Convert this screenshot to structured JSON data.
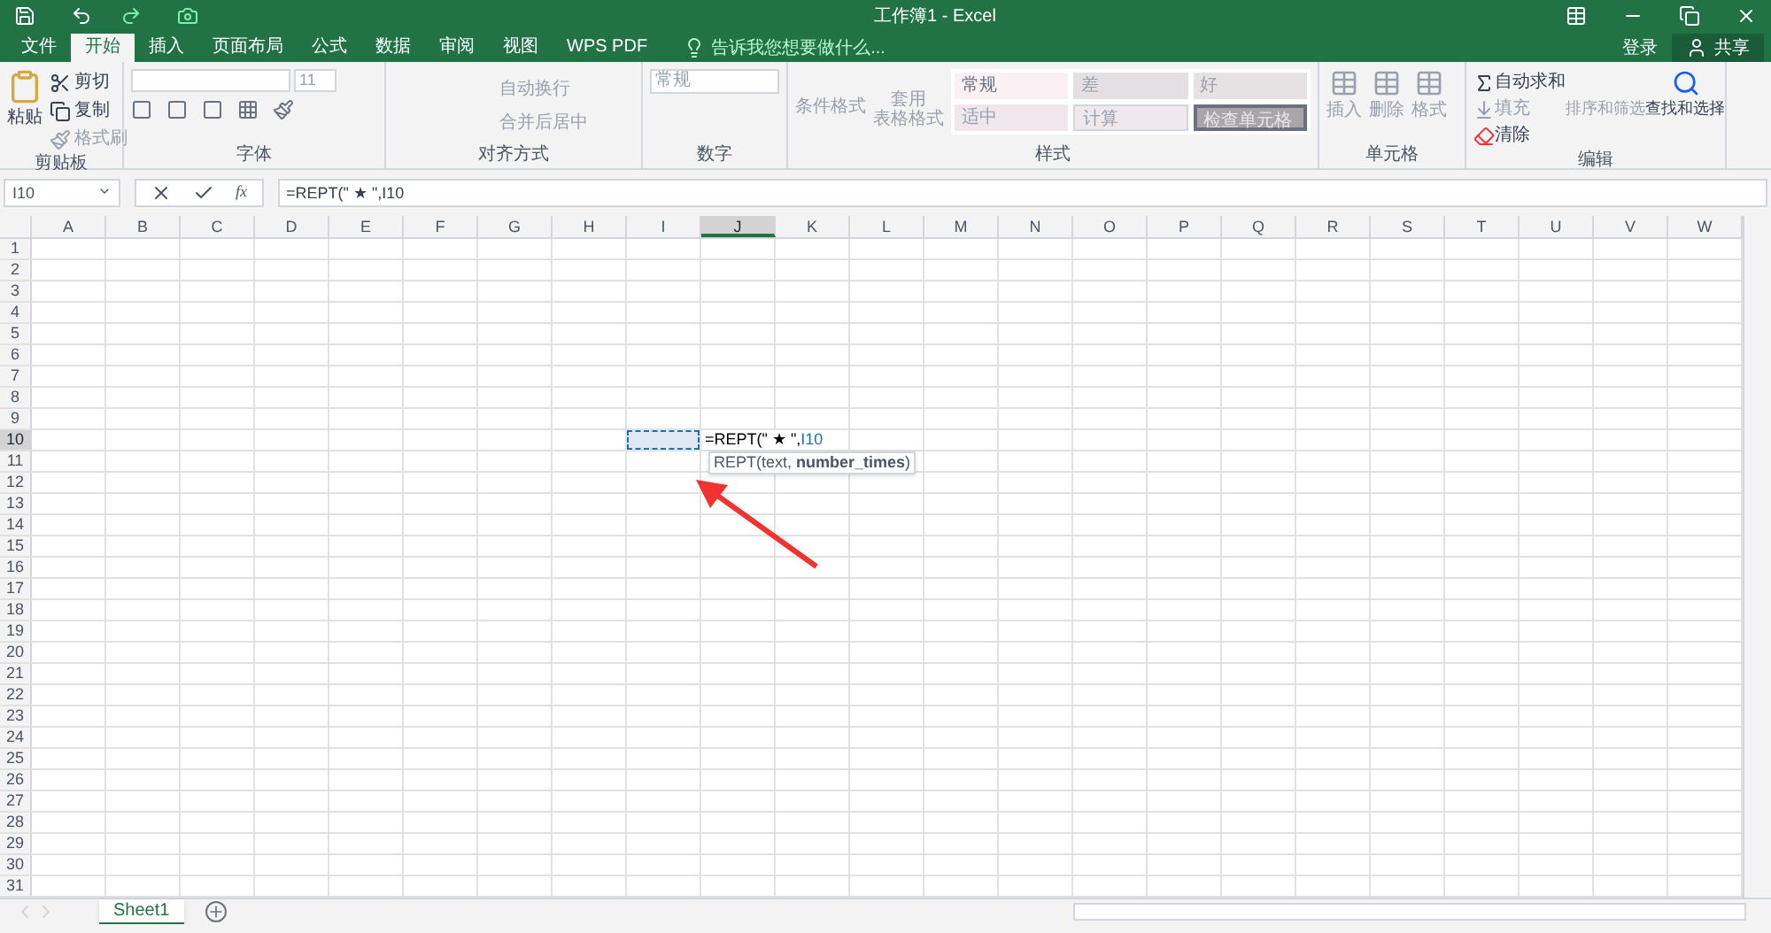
{
  "window": {
    "title": "工作簿1 - Excel"
  },
  "tabs": [
    {
      "label": "文件",
      "selected": false
    },
    {
      "label": "开始",
      "selected": true
    },
    {
      "label": "插入",
      "selected": false
    },
    {
      "label": "页面布局",
      "selected": false
    },
    {
      "label": "公式",
      "selected": false
    },
    {
      "label": "数据",
      "selected": false
    },
    {
      "label": "审阅",
      "selected": false
    },
    {
      "label": "视图",
      "selected": false
    },
    {
      "label": "WPS PDF",
      "selected": false
    }
  ],
  "tell_me": {
    "placeholder": "告诉我您想要做什么..."
  },
  "account": {
    "sign_in": "登录",
    "share": "共享"
  },
  "ribbon": {
    "clipboard": {
      "label": "剪贴板",
      "paste": "粘贴",
      "cut": "剪切",
      "copy": "复制",
      "format_painter": "格式刷"
    },
    "font": {
      "label": "字体",
      "size": "11"
    },
    "alignment": {
      "label": "对齐方式",
      "wrap": "自动换行",
      "merge": "合并后居中"
    },
    "number": {
      "label": "数字",
      "format": "常规"
    },
    "styles": {
      "label": "样式",
      "conditional": "条件格式",
      "table_format": [
        "套用",
        "表格格式"
      ],
      "cells": [
        {
          "label": "常规",
          "kind": "normal"
        },
        {
          "label": "差",
          "kind": "bad"
        },
        {
          "label": "好",
          "kind": "good"
        },
        {
          "label": "适中",
          "kind": "neutral"
        },
        {
          "label": "计算",
          "kind": "calc"
        },
        {
          "label": "检查单元格",
          "kind": "check"
        }
      ]
    },
    "cells": {
      "label": "单元格",
      "insert": "插入",
      "delete": "删除",
      "format": "格式"
    },
    "editing": {
      "label": "编辑",
      "autosum": "自动求和",
      "fill": "填充",
      "clear": "清除",
      "sort": "排序和筛选",
      "find": "查找和选择"
    }
  },
  "formula_bar": {
    "name_box": "I10",
    "function_label": "fx",
    "formula": "=REPT(\" ★ \",I10"
  },
  "sheet": {
    "columns": [
      {
        "label": "A",
        "selected": false
      },
      {
        "label": "B",
        "selected": false
      },
      {
        "label": "C",
        "selected": false
      },
      {
        "label": "D",
        "selected": false
      },
      {
        "label": "E",
        "selected": false
      },
      {
        "label": "F",
        "selected": false
      },
      {
        "label": "G",
        "selected": false
      },
      {
        "label": "H",
        "selected": false
      },
      {
        "label": "I",
        "selected": false
      },
      {
        "label": "J",
        "selected": true
      },
      {
        "label": "K",
        "selected": false
      },
      {
        "label": "L",
        "selected": false
      },
      {
        "label": "M",
        "selected": false
      },
      {
        "label": "N",
        "selected": false
      },
      {
        "label": "O",
        "selected": false
      },
      {
        "label": "P",
        "selected": false
      },
      {
        "label": "Q",
        "selected": false
      },
      {
        "label": "R",
        "selected": false
      },
      {
        "label": "S",
        "selected": false
      },
      {
        "label": "T",
        "selected": false
      },
      {
        "label": "U",
        "selected": false
      },
      {
        "label": "V",
        "selected": false
      },
      {
        "label": "W",
        "selected": false
      }
    ],
    "rows": [
      {
        "label": "1",
        "selected": false
      },
      {
        "label": "2",
        "selected": false
      },
      {
        "label": "3",
        "selected": false
      },
      {
        "label": "4",
        "selected": false
      },
      {
        "label": "5",
        "selected": false
      },
      {
        "label": "6",
        "selected": false
      },
      {
        "label": "7",
        "selected": false
      },
      {
        "label": "8",
        "selected": false
      },
      {
        "label": "9",
        "selected": false
      },
      {
        "label": "10",
        "selected": true
      },
      {
        "label": "11",
        "selected": false
      },
      {
        "label": "12",
        "selected": false
      },
      {
        "label": "13",
        "selected": false
      },
      {
        "label": "14",
        "selected": false
      },
      {
        "label": "15",
        "selected": false
      },
      {
        "label": "16",
        "selected": false
      },
      {
        "label": "17",
        "selected": false
      },
      {
        "label": "18",
        "selected": false
      },
      {
        "label": "19",
        "selected": false
      },
      {
        "label": "20",
        "selected": false
      },
      {
        "label": "21",
        "selected": false
      },
      {
        "label": "22",
        "selected": false
      },
      {
        "label": "23",
        "selected": false
      },
      {
        "label": "24",
        "selected": false
      },
      {
        "label": "25",
        "selected": false
      },
      {
        "label": "26",
        "selected": false
      },
      {
        "label": "27",
        "selected": false
      },
      {
        "label": "28",
        "selected": false
      },
      {
        "label": "29",
        "selected": false
      },
      {
        "label": "30",
        "selected": false
      },
      {
        "label": "31",
        "selected": false
      }
    ],
    "editing_cell": {
      "text": "=REPT(\" ★ \",",
      "reference": "I10"
    },
    "tooltip": "REPT(text, **number_times**)"
  },
  "sheet_tabs": [
    {
      "label": "Sheet1",
      "selected": true
    }
  ]
}
